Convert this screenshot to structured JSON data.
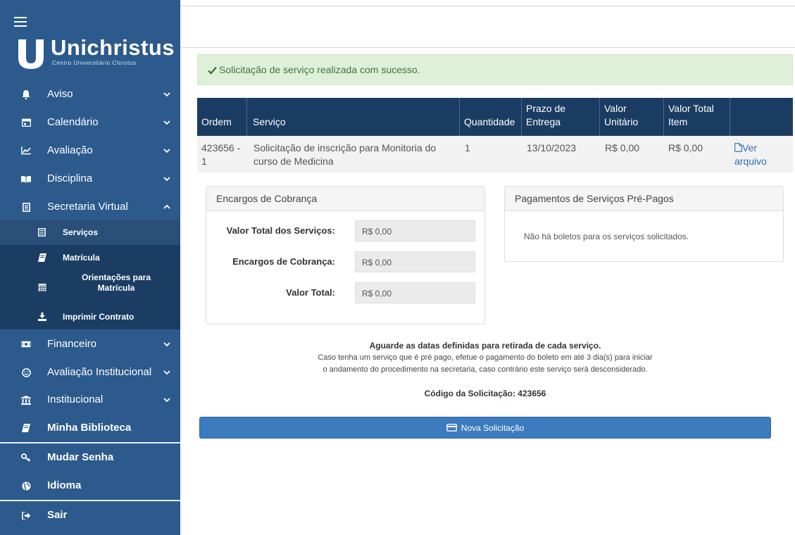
{
  "brand": {
    "name": "Unichristus",
    "subtitle": "Centro Universitário Christus"
  },
  "sidebar": {
    "items": [
      {
        "label": "Aviso",
        "icon": "bell-icon"
      },
      {
        "label": "Calendário",
        "icon": "calendar-icon"
      },
      {
        "label": "Avaliação",
        "icon": "line-chart-icon"
      },
      {
        "label": "Disciplina",
        "icon": "book-open-icon"
      },
      {
        "label": "Secretaria Virtual",
        "icon": "file-icon"
      }
    ],
    "submenu": [
      {
        "label": "Serviços",
        "icon": "list-icon",
        "active": true
      },
      {
        "label": "Matrícula",
        "icon": "book-icon"
      },
      {
        "label": "Orientações para Matrícula",
        "icon": "calendar-grid-icon"
      },
      {
        "label": "Imprimir Contrato",
        "icon": "download-icon"
      }
    ],
    "items_after": [
      {
        "label": "Financeiro",
        "icon": "money-icon"
      },
      {
        "label": "Avaliação Institucional",
        "icon": "smile-icon"
      },
      {
        "label": "Institucional",
        "icon": "institution-icon"
      },
      {
        "label": "Minha Biblioteca",
        "icon": "book-icon"
      }
    ],
    "account": [
      {
        "label": "Mudar Senha",
        "icon": "key-icon"
      },
      {
        "label": "Idioma",
        "icon": "globe-icon"
      }
    ],
    "logout": {
      "label": "Sair",
      "icon": "sign-out-icon"
    }
  },
  "alert": {
    "message": "Solicitação de serviço realizada com sucesso."
  },
  "table": {
    "headers": {
      "ordem": "Ordem",
      "servico": "Serviço",
      "quantidade": "Quantidade",
      "prazo_1": "Prazo de",
      "prazo_2": "Entrega",
      "valor_1": "Valor",
      "valor_2": "Unitário",
      "total_1": "Valor Total",
      "total_2": "Item"
    },
    "rows": [
      {
        "ordem_1": "423656 -",
        "ordem_2": "1",
        "servico_1": "Solicitação de inscrição para Monitoria do",
        "servico_2": "curso de Medicina",
        "quantidade": "1",
        "prazo": "13/10/2023",
        "valor_unitario": "R$ 0,00",
        "valor_total": "R$ 0,00",
        "link_1": "Ver",
        "link_2": "arquivo"
      }
    ]
  },
  "encargos": {
    "title": "Encargos de Cobrança",
    "fields": [
      {
        "label": "Valor Total dos Serviços:",
        "value": "R$ 0,00"
      },
      {
        "label": "Encargos de Cobrança:",
        "value": "R$ 0,00"
      },
      {
        "label": "Valor Total:",
        "value": "R$ 0,00"
      }
    ]
  },
  "pagamentos": {
    "title": "Pagamentos de Serviços Pré-Pagos",
    "empty": "Não há boletos para os serviços solicitados."
  },
  "info": {
    "heading": "Aguarde as datas definidas para retirada de cada serviço.",
    "line1": "Caso tenha um serviço que é pré pago, efetue o pagamento do boleto em até 3 dia(s) para iniciar",
    "line2": "o andamento do procedimento na secretaria, caso contrário este serviço será desconsiderado.",
    "codigo": "Código da Solicitação: 423656"
  },
  "button": {
    "label": "Nova Solicitação"
  },
  "colors": {
    "sidebar": "#2c5a8c",
    "submenu": "#1b3d63",
    "table_header": "#1b3c62",
    "alert_bg": "#dff0d8",
    "alert_text": "#3c763d",
    "button": "#3c7bbd"
  }
}
